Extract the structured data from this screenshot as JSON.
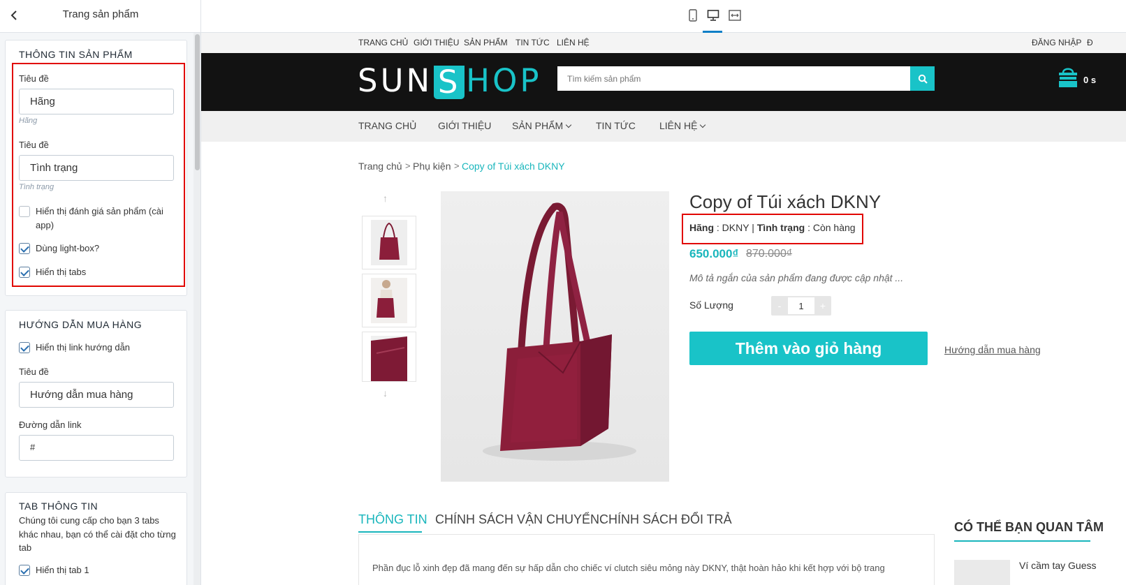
{
  "sidebar": {
    "title": "Trang sản phẩm",
    "product_info": {
      "heading": "THÔNG TIN SẢN PHẨM",
      "field1_label": "Tiêu đề",
      "field1_value": "Hãng",
      "field1_hint": "Hãng",
      "field2_label": "Tiêu đề",
      "field2_value": "Tình trạng",
      "field2_hint": "Tình trạng",
      "checkboxes": [
        {
          "label": "Hiển thị đánh giá sản phẩm (cài app)",
          "checked": false
        },
        {
          "label": "Dùng light-box?",
          "checked": true
        },
        {
          "label": "Hiển thị tabs",
          "checked": true
        }
      ]
    },
    "buy_guide": {
      "heading": "HƯỚNG DẪN MUA HÀNG",
      "checkbox_label": "Hiển thị link hướng dẫn",
      "checkbox_checked": true,
      "title_label": "Tiêu đề",
      "title_value": "Hướng dẫn mua hàng",
      "link_label": "Đường dẫn link",
      "link_value": "#"
    },
    "tab_info": {
      "heading": "TAB THÔNG TIN",
      "description": "Chúng tôi cung cấp cho bạn 3 tabs khác nhau, bạn có thể cài đặt cho từng tab",
      "partial_checkbox_label": "Hiển thị tab 1"
    }
  },
  "toolbar": {
    "icons": [
      "mobile-icon",
      "desktop-icon",
      "fullwidth-icon"
    ],
    "active": "desktop-icon"
  },
  "store": {
    "topbar": {
      "links": [
        "TRANG CHỦ",
        "GIỚI THIỆU",
        "SẢN PHẨM",
        "TIN TỨC",
        "LIÊN HỆ"
      ],
      "login": "ĐĂNG NHẬP",
      "register_partial": "Đ"
    },
    "logo": {
      "part1": "SUN",
      "part2": "S",
      "part3": "HOP"
    },
    "search": {
      "placeholder": "Tìm kiếm sản phẩm"
    },
    "cart": {
      "count": "0 s"
    },
    "nav": [
      "TRANG CHỦ",
      "GIỚI THIỆU",
      "SẢN PHẨM",
      "TIN TỨC",
      "LIÊN HỆ"
    ],
    "breadcrumb": [
      "Trang chủ",
      "Phụ kiện",
      "Copy of Túi xách DKNY"
    ],
    "breadcrumb_sep": ">",
    "product": {
      "title": "Copy of Túi xách DKNY",
      "brand_label": "Hãng",
      "brand_value": "DKNY",
      "status_label": "Tình trạng",
      "status_value": "Còn hàng",
      "price": "650.000₫",
      "old_price": "870.000₫",
      "short_desc": "Mô tả ngắn của sản phẩm đang được cập nhật ...",
      "qty_label": "Số Lượng",
      "qty_value": "1",
      "qty_minus": "-",
      "qty_plus": "+",
      "add_to_cart": "Thêm vào giỏ hàng",
      "guide_link": "Hướng dẫn mua hàng"
    },
    "tabs": [
      "THÔNG TIN",
      "CHÍNH SÁCH VẬN CHUYỂN",
      "CHÍNH SÁCH ĐỔI TRẢ"
    ],
    "tab_text": "Phần đục lỗ xinh đẹp đã mang đến sự hấp dẫn cho chiếc ví clutch siêu mỏng này DKNY, thật hoàn hảo khi kết hợp với bộ trang",
    "related": {
      "title": "CÓ THỂ BẠN QUAN TÂM",
      "first_item": "Ví cầm tay Guess"
    }
  },
  "colors": {
    "accent": "#19c3c8",
    "header_bg": "#121212",
    "highlight_box": "#e10600",
    "product_color": "#8b1e3a"
  }
}
